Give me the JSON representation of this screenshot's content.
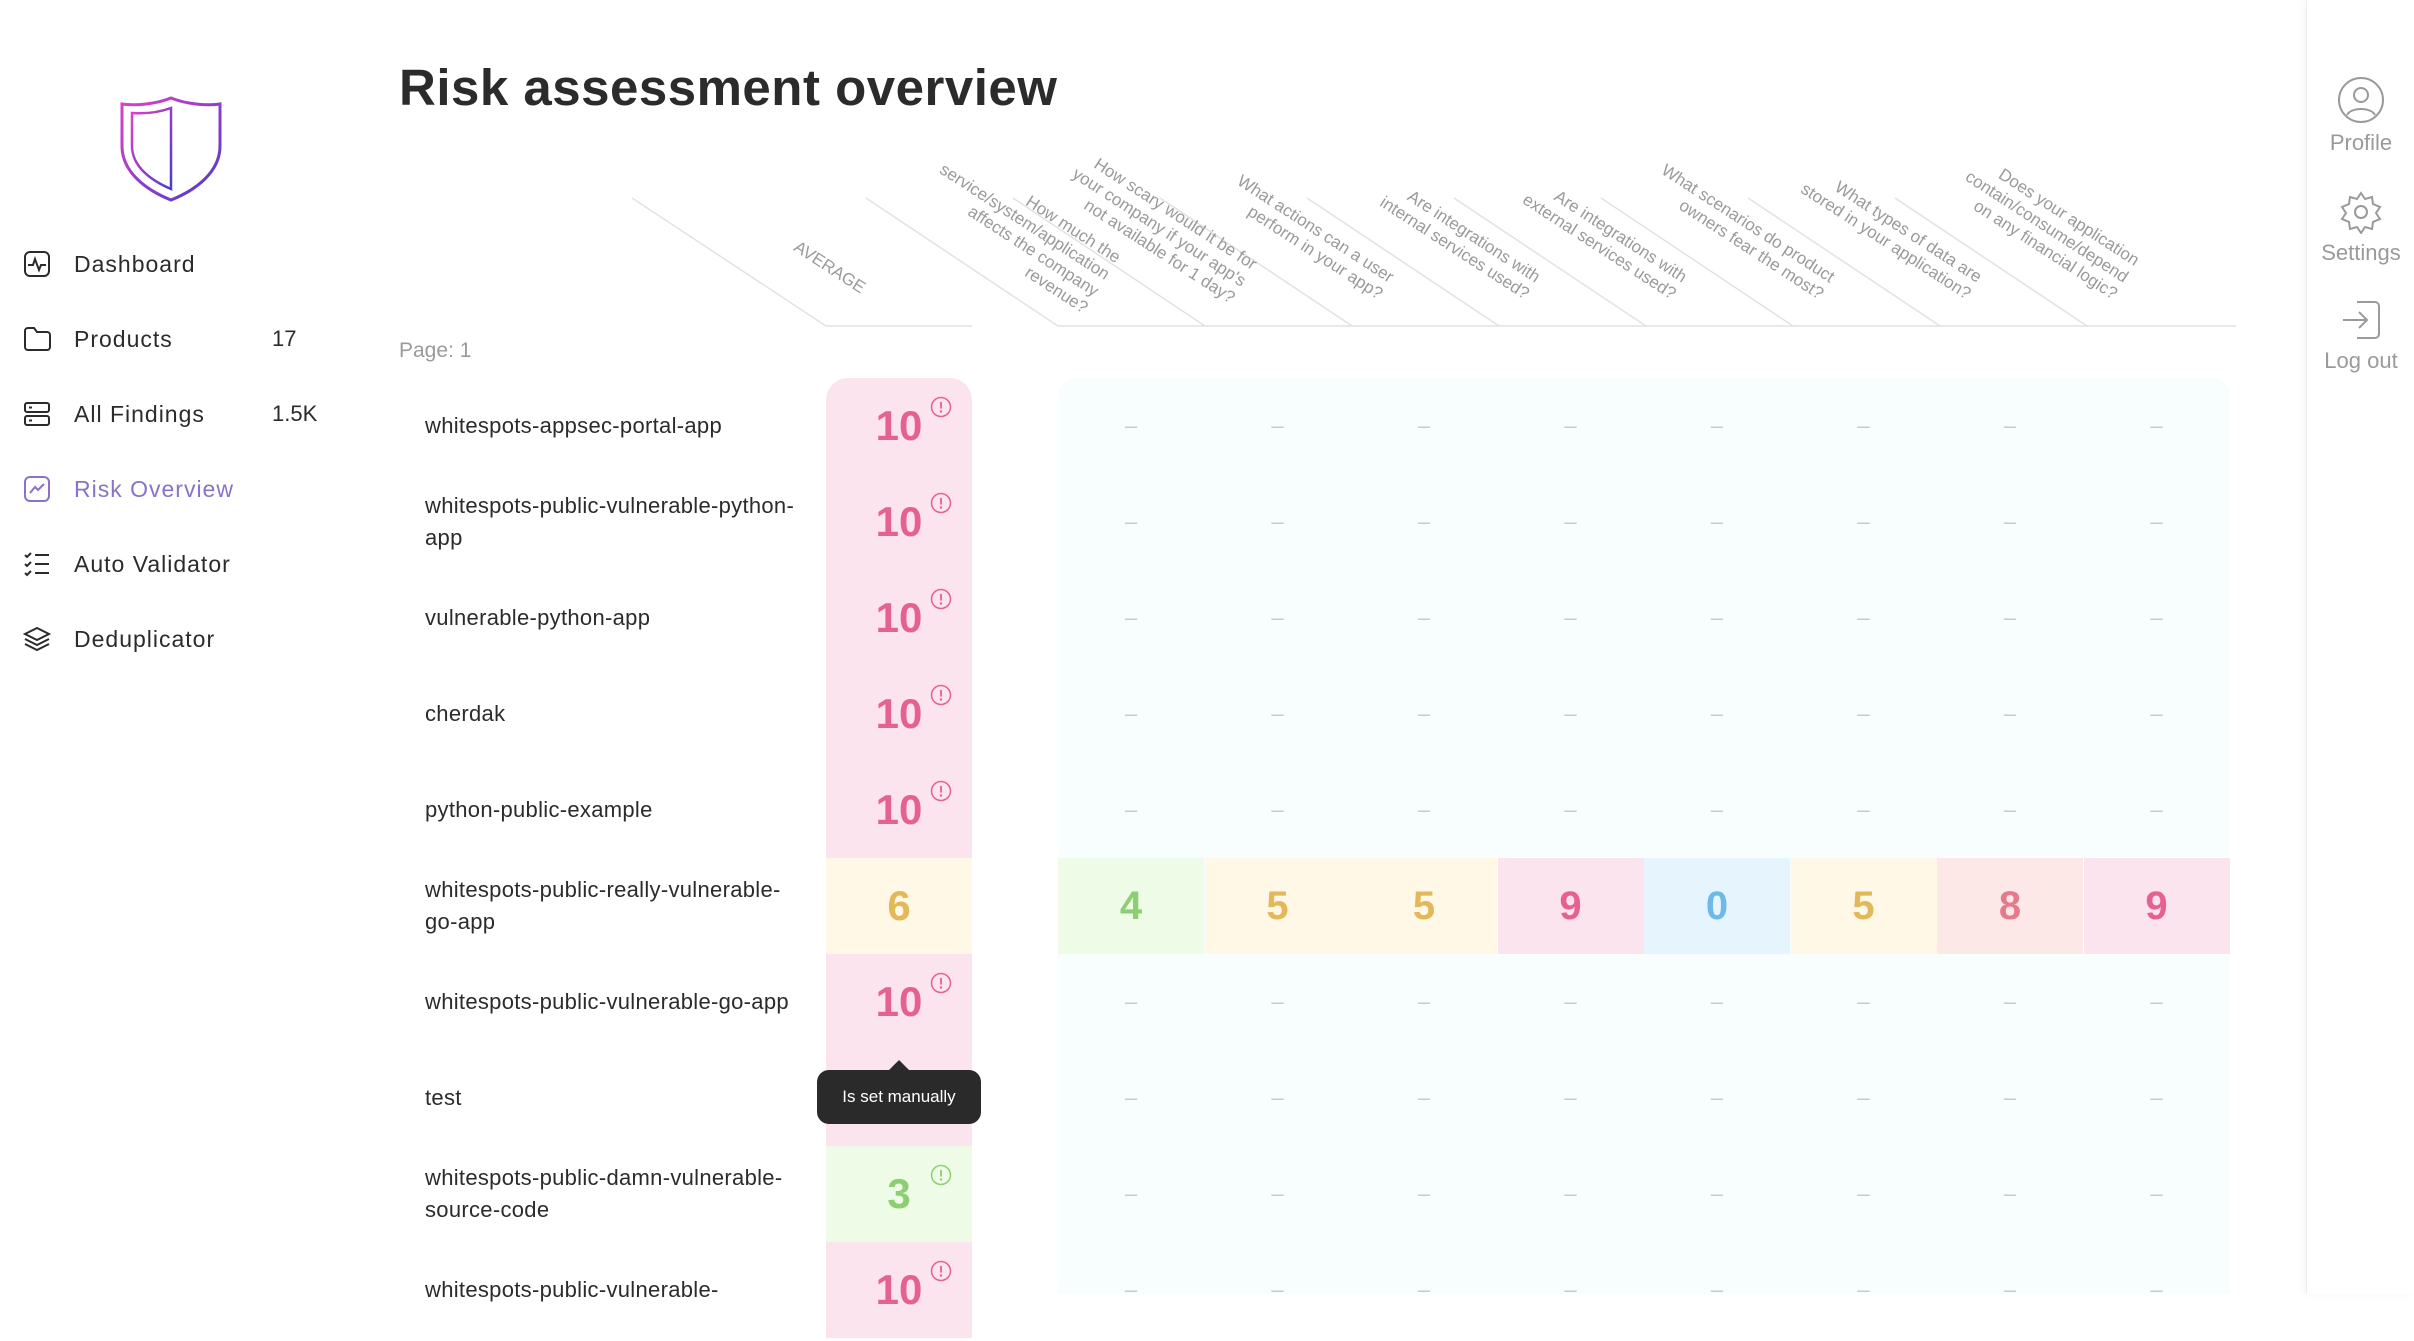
{
  "sidebar": {
    "items": [
      {
        "label": "Dashboard",
        "icon": "activity-icon",
        "count": ""
      },
      {
        "label": "Products",
        "icon": "folder-icon",
        "count": "17"
      },
      {
        "label": "All Findings",
        "icon": "server-icon",
        "count": "1.5K"
      },
      {
        "label": "Risk Overview",
        "icon": "chart-icon",
        "count": "",
        "active": true
      },
      {
        "label": "Auto Validator",
        "icon": "checklist-icon",
        "count": ""
      },
      {
        "label": "Deduplicator",
        "icon": "layers-icon",
        "count": ""
      }
    ]
  },
  "rail": {
    "profile": "Profile",
    "settings": "Settings",
    "logout": "Log out"
  },
  "main": {
    "title": "Risk assessment overview",
    "page": "Page: 1",
    "tooltip": "Is set manually",
    "headers": [
      "AVERAGE",
      "How much the\nservice/system/application\naffects the company\nrevenue?",
      "How scary would it be for\nyour company if your app's\nnot available for 1 day?",
      "What actions can a user\nperform in your app?",
      "Are integrations with\ninternal services used?",
      "Are integrations with\nexternal services used?",
      "What scenarios do product\nowners fear the most?",
      "What types of data are\nstored in your application?",
      "Does your application\ncontain/consume/depend\non any financial logic?"
    ],
    "rows": [
      {
        "name": "whitespots-appsec-portal-app",
        "avg": "10",
        "manual": true,
        "scores": []
      },
      {
        "name": "whitespots-public-vulnerable-python-app",
        "avg": "10",
        "manual": true,
        "scores": []
      },
      {
        "name": "vulnerable-python-app",
        "avg": "10",
        "manual": true,
        "scores": []
      },
      {
        "name": "cherdak",
        "avg": "10",
        "manual": true,
        "scores": []
      },
      {
        "name": "python-public-example",
        "avg": "10",
        "manual": true,
        "scores": []
      },
      {
        "name": "whitespots-public-really-vulnerable-go-app",
        "avg": "6",
        "manual": false,
        "scores": [
          "4",
          "5",
          "5",
          "9",
          "0",
          "5",
          "8",
          "9"
        ]
      },
      {
        "name": "whitespots-public-vulnerable-go-app",
        "avg": "10",
        "manual": true,
        "scores": []
      },
      {
        "name": "test",
        "avg": "",
        "manual": false,
        "scores": []
      },
      {
        "name": "whitespots-public-damn-vulnerable-source-code",
        "avg": "3",
        "manual": true,
        "scores": []
      },
      {
        "name": "whitespots-public-vulnerable-",
        "avg": "10",
        "manual": true,
        "scores": []
      }
    ],
    "empty_dash": "–"
  },
  "colors": {
    "accent": "#8a72c8",
    "high_bg": "#fce4ef",
    "high_fg": "#e6618f",
    "mid_bg": "#fff8e6",
    "mid_fg": "#e2b85a",
    "low_bg": "#eefbe6",
    "low_fg": "#8ccf72",
    "zero_bg": "#e6f5fd",
    "zero_fg": "#6fb9e8",
    "warn_bg": "#fde8e8",
    "warn_fg": "#e67a8a"
  }
}
